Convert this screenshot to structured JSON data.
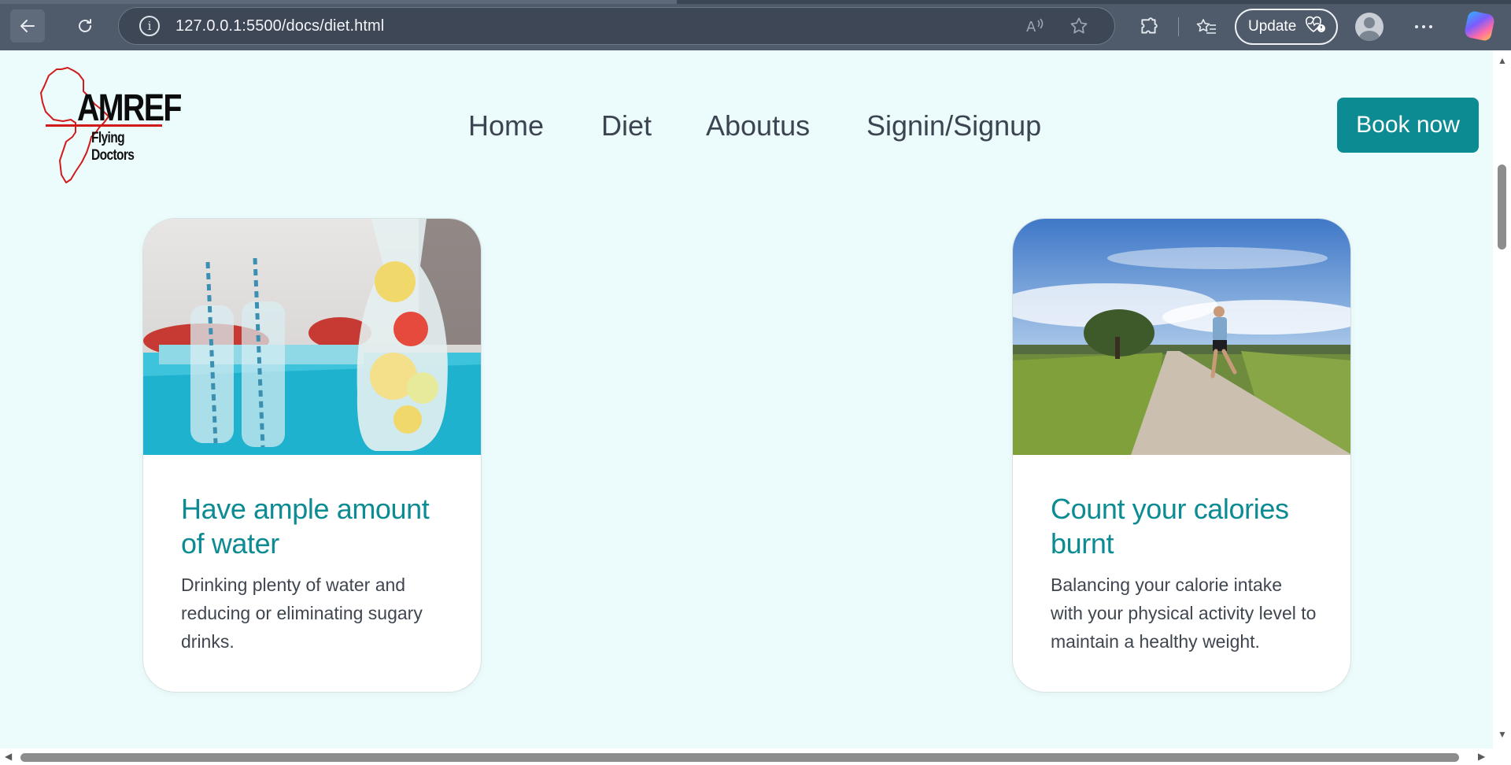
{
  "browser": {
    "url": "127.0.0.1:5500/docs/diet.html",
    "update_label": "Update",
    "icons": [
      "back-arrow-icon",
      "reload-icon",
      "info-icon",
      "read-aloud-icon",
      "favorite-star-icon",
      "extensions-icon",
      "favorites-icon",
      "heart-pulse-icon",
      "profile-avatar-icon",
      "more-icon",
      "copilot-icon"
    ],
    "colors": {
      "chrome": "#4f5b6b",
      "address_bar": "#3d4756"
    }
  },
  "site": {
    "logo": {
      "brand": "AMREF",
      "tagline": "Flying Doctors"
    },
    "nav": {
      "home": "Home",
      "diet": "Diet",
      "about": "Aboutus",
      "signin": "Signin/Signup"
    },
    "cta": "Book now",
    "colors": {
      "accent": "#0d8b93",
      "page_bg": "#ecfbfb"
    }
  },
  "cards": [
    {
      "title": "Have ample amount of water",
      "text": "Drinking plenty of water and reducing or eliminating sugary drinks.",
      "image": "infused-water-jars-photo"
    },
    {
      "title": "Count your calories burnt",
      "text": "Balancing your calorie intake with your physical activity level to maintain a healthy weight.",
      "image": "runner-on-country-road-photo"
    }
  ]
}
